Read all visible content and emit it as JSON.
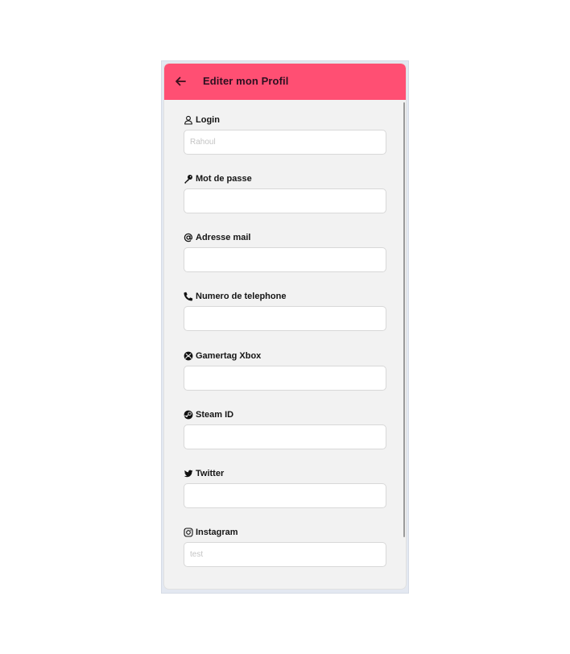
{
  "header": {
    "back_icon": "arrow-left-icon",
    "title": "Editer mon Profil",
    "color": "#ff4f73"
  },
  "fields": [
    {
      "key": "login",
      "icon": "user-icon",
      "label": "Login",
      "value": "",
      "placeholder": "Rahoul"
    },
    {
      "key": "password",
      "icon": "key-icon",
      "label": "Mot de passe",
      "value": "",
      "placeholder": ""
    },
    {
      "key": "email",
      "icon": "at-icon",
      "label": "Adresse mail",
      "value": "",
      "placeholder": ""
    },
    {
      "key": "phone",
      "icon": "phone-icon",
      "label": "Numero de telephone",
      "value": "",
      "placeholder": ""
    },
    {
      "key": "xbox",
      "icon": "xbox-icon",
      "label": "Gamertag Xbox",
      "value": "",
      "placeholder": ""
    },
    {
      "key": "steam",
      "icon": "steam-icon",
      "label": "Steam ID",
      "value": "",
      "placeholder": ""
    },
    {
      "key": "twitter",
      "icon": "twitter-icon",
      "label": "Twitter",
      "value": "",
      "placeholder": ""
    },
    {
      "key": "instagram",
      "icon": "instagram-icon",
      "label": "Instagram",
      "value": "",
      "placeholder": "test"
    }
  ]
}
